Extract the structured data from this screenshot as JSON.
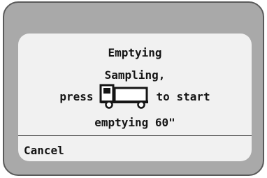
{
  "dialog": {
    "title": "Emptying",
    "line1": "Sampling,",
    "line2_prefix": "press",
    "line2_suffix": "to start",
    "line3": "emptying 60\""
  },
  "softkeys": {
    "left": "Cancel"
  },
  "icons": {
    "action": "truck-icon"
  },
  "colors": {
    "bezel": "#a9a9a9",
    "screen": "#f1f1f1",
    "text": "#151515"
  }
}
